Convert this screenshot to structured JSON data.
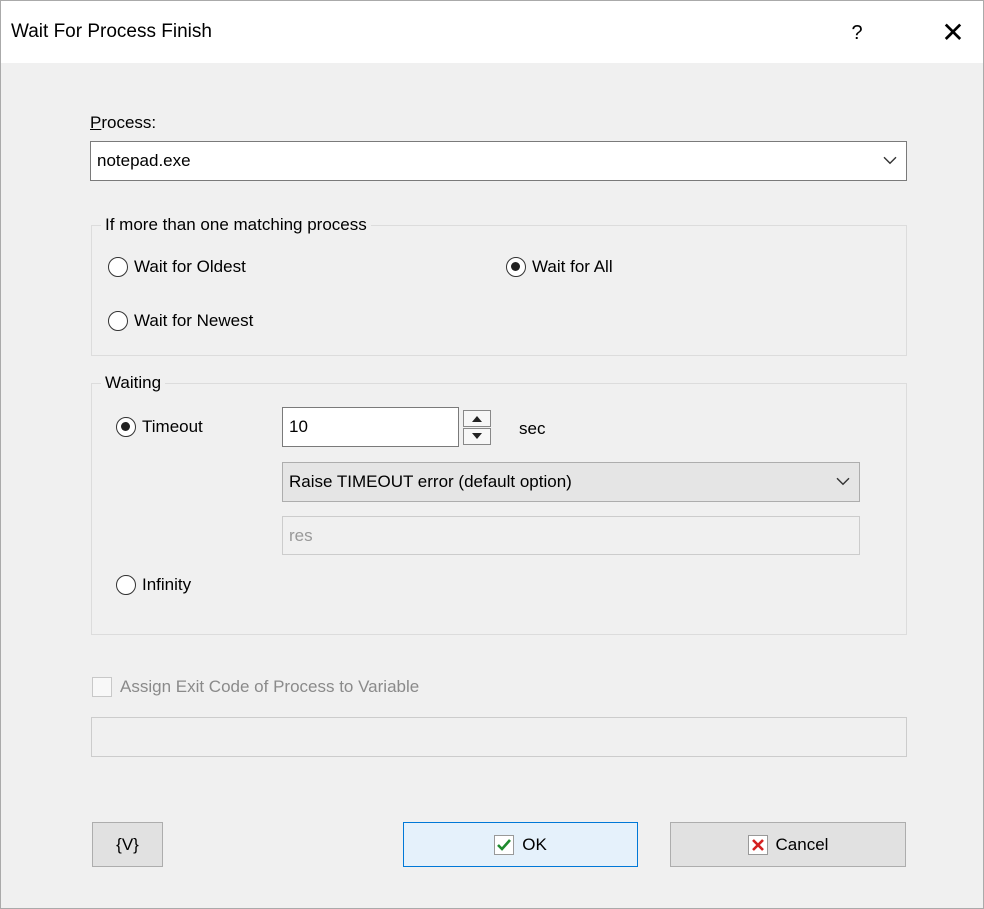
{
  "window": {
    "title": "Wait For Process Finish",
    "help_label": "?",
    "close_label": "✕"
  },
  "process": {
    "label_ul": "P",
    "label_rest": "rocess:",
    "value": "notepad.exe"
  },
  "matching": {
    "title": "If more than one matching process",
    "options": [
      {
        "label": "Wait for Oldest",
        "selected": false
      },
      {
        "label": "Wait for All",
        "selected": true
      },
      {
        "label": "Wait for Newest",
        "selected": false
      }
    ]
  },
  "waiting": {
    "title": "Waiting",
    "timeout_label": "Timeout",
    "timeout_selected": true,
    "timeout_value": "10",
    "unit": "sec",
    "error_option": "Raise TIMEOUT error (default option)",
    "result_placeholder": "res",
    "infinity_label": "Infinity",
    "infinity_selected": false
  },
  "exit_code": {
    "label": "Assign Exit Code of Process to Variable",
    "checked": false,
    "value": ""
  },
  "buttons": {
    "variables": "{V}",
    "ok": "OK",
    "cancel": "Cancel"
  },
  "colors": {
    "ok_check": "#1e8a2e",
    "cancel_x": "#d42020",
    "focus_border": "#0078d7"
  }
}
